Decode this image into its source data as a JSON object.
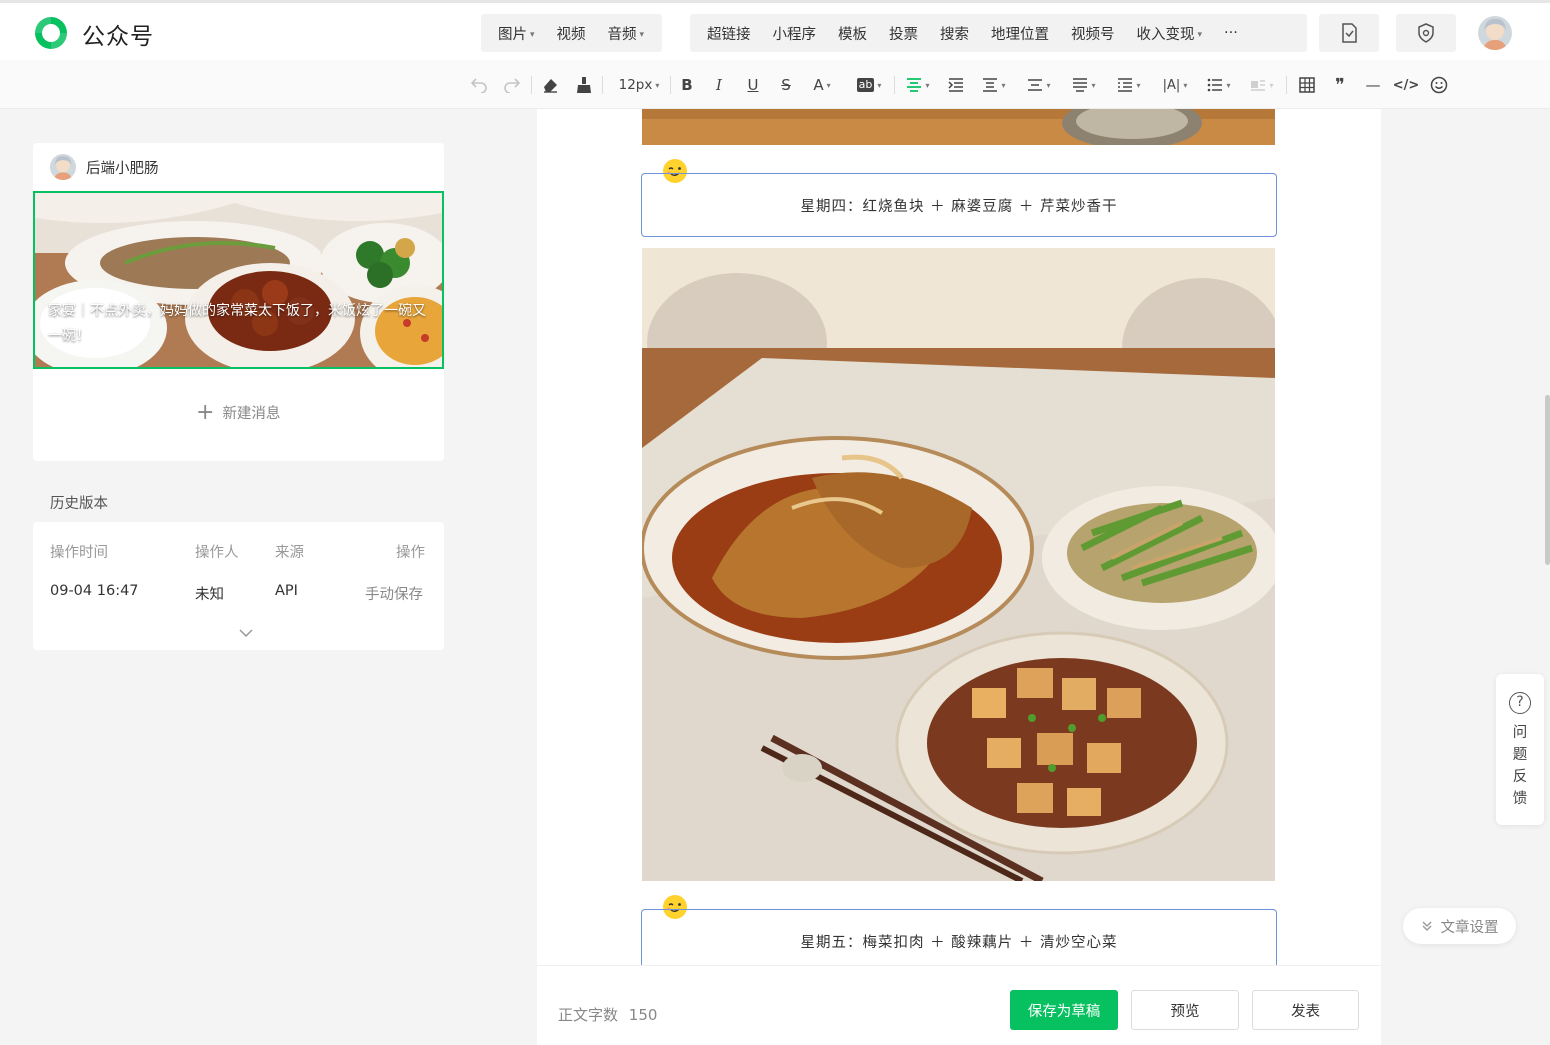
{
  "header": {
    "brand": "公众号",
    "media_menu": [
      "图片",
      "视频",
      "音频"
    ],
    "insert_menu": [
      "超链接",
      "小程序",
      "模板",
      "投票",
      "搜索",
      "地理位置",
      "视频号",
      "收入变现"
    ],
    "more": "···"
  },
  "toolbar": {
    "font_size": "12px",
    "bold": "B",
    "italic": "I",
    "underline": "U",
    "strike": "S",
    "font_color": "A",
    "highlight": "ab",
    "letter_spacing": "|A|",
    "quote": "❞",
    "hr": "—",
    "code": "</>"
  },
  "left": {
    "author": "后端小肥肠",
    "cover_title": "家宴｜不点外卖，妈妈做的家常菜太下饭了，米饭炫了一碗又一碗！",
    "new_message": "新建消息",
    "new_message_icon": "+",
    "history_title": "历史版本",
    "history_headers": [
      "操作时间",
      "操作人",
      "来源",
      "操作"
    ],
    "history_rows": [
      {
        "time": "09-04 16:47",
        "operator": "未知",
        "source": "API",
        "action": "手动保存"
      }
    ]
  },
  "editor": {
    "day_thursday": "星期四：红烧鱼块 ＋ 麻婆豆腐 ＋ 芹菜炒香干",
    "day_friday": "星期五：梅菜扣肉 ＋ 酸辣藕片 ＋ 清炒空心菜"
  },
  "footer": {
    "word_count_label": "正文字数",
    "word_count": "150",
    "save_draft": "保存为草稿",
    "preview": "预览",
    "publish": "发表"
  },
  "side": {
    "feedback_icon": "?",
    "feedback": "问题反馈",
    "feedback_chars": [
      "问",
      "题",
      "反",
      "馈"
    ],
    "article_settings": "文章设置"
  },
  "colors": {
    "accent": "#07c160",
    "box_border": "#6e93d8"
  }
}
